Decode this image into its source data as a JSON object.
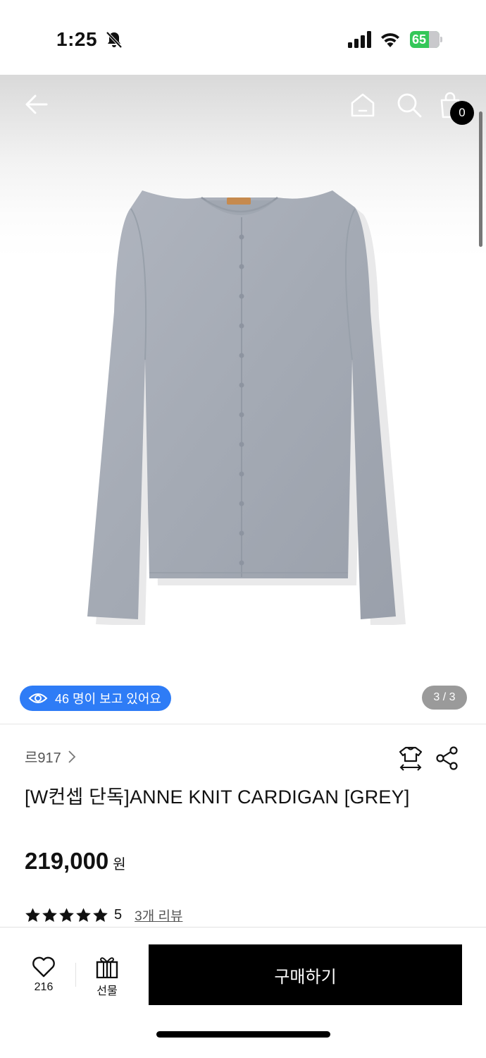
{
  "status_bar": {
    "time": "1:25",
    "battery": "65",
    "battery_percent": 65,
    "icons": [
      "bell-slash-icon",
      "signal-icon",
      "wifi-icon",
      "battery-icon"
    ]
  },
  "nav": {
    "icons": [
      "back-arrow-icon",
      "home-icon",
      "search-icon",
      "cart-icon"
    ],
    "cart_count": "0"
  },
  "hero": {
    "image": "grey-knit-cardigan",
    "viewers_text": "46 명이 보고 있어요",
    "page_indicator": "3 / 3"
  },
  "product": {
    "brand": "르917",
    "title": "[W컨셉 단독]ANNE KNIT CARDIGAN [GREY]",
    "price": "219,000",
    "currency": "원",
    "rating": "5",
    "stars": 5,
    "review_link": "3개 리뷰"
  },
  "bottom_bar": {
    "like_count": "216",
    "gift_label": "선물",
    "buy_label": "구매하기"
  },
  "colors": {
    "accent_blue": "#2e7cf6",
    "battery_green": "#34c759",
    "cardigan_grey": "#a5abb5",
    "button_black": "#000000"
  }
}
